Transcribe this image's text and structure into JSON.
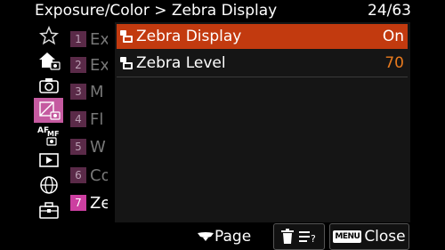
{
  "header": {
    "title": "Exposure/Color > Zebra Display",
    "page": "24/63"
  },
  "categories": [
    {
      "icon": "star-icon",
      "active": false
    },
    {
      "icon": "home-camera-icon",
      "active": false
    },
    {
      "icon": "camera-icon",
      "active": false
    },
    {
      "icon": "exposure-camera-icon",
      "active": true
    },
    {
      "icon": "af-mf-icon",
      "active": false
    },
    {
      "icon": "playback-icon",
      "active": false
    },
    {
      "icon": "network-icon",
      "active": false
    },
    {
      "icon": "toolbox-icon",
      "active": false
    }
  ],
  "submenu": [
    {
      "num": "1",
      "text": "Ex"
    },
    {
      "num": "2",
      "text": "Ex"
    },
    {
      "num": "3",
      "text": "M"
    },
    {
      "num": "4",
      "text": "Fl"
    },
    {
      "num": "5",
      "text": "W"
    },
    {
      "num": "6",
      "text": "Co"
    },
    {
      "num": "7",
      "text": "Ze",
      "active": true
    }
  ],
  "items": [
    {
      "label": "Zebra Display",
      "value": "On",
      "selected": true,
      "icon": "movie-camera-icon"
    },
    {
      "label": "Zebra Level",
      "value": "70",
      "selected": false,
      "icon": "movie-camera-icon"
    }
  ],
  "footer": {
    "page_label": "Page",
    "close_label": "Close",
    "menu_chip": "MENU"
  },
  "colors": {
    "selected_row": "#c23a0f",
    "active_category": "#c55aa0",
    "value_orange": "#e87a1e"
  }
}
